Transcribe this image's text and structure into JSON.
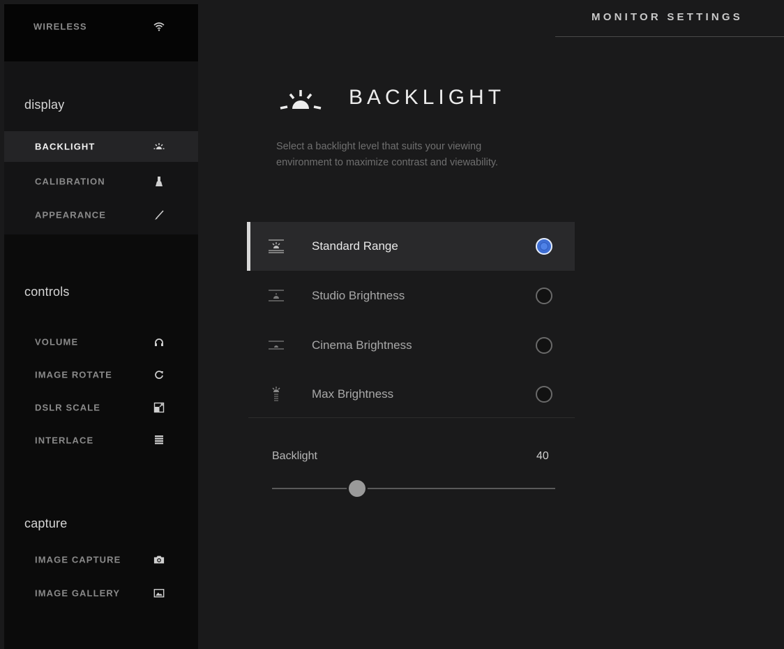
{
  "header": {
    "title": "MONITOR SETTINGS"
  },
  "sidebar": {
    "wireless": {
      "label": "WIRELESS",
      "icon": "wifi-icon"
    },
    "sections": {
      "display": {
        "title": "display",
        "items": [
          {
            "label": "BACKLIGHT",
            "icon": "backlight-icon",
            "active": true
          },
          {
            "label": "CALIBRATION",
            "icon": "calibration-probe-icon",
            "active": false
          },
          {
            "label": "APPEARANCE",
            "icon": "brush-icon",
            "active": false
          }
        ]
      },
      "controls": {
        "title": "controls",
        "items": [
          {
            "label": "VOLUME",
            "icon": "headphones-icon"
          },
          {
            "label": "IMAGE ROTATE",
            "icon": "rotate-icon"
          },
          {
            "label": "DSLR SCALE",
            "icon": "scale-icon"
          },
          {
            "label": "INTERLACE",
            "icon": "interlace-icon"
          }
        ]
      },
      "capture": {
        "title": "capture",
        "items": [
          {
            "label": "IMAGE CAPTURE",
            "icon": "camera-icon"
          },
          {
            "label": "IMAGE GALLERY",
            "icon": "gallery-icon"
          }
        ]
      }
    }
  },
  "panel": {
    "title": "BACKLIGHT",
    "icon": "backlight-icon",
    "description": "Select a backlight level that suits your viewing environment to maximize contrast and viewability.",
    "options": [
      {
        "label": "Standard Range",
        "icon": "standard-range-icon",
        "selected": true
      },
      {
        "label": "Studio Brightness",
        "icon": "studio-brightness-icon",
        "selected": false
      },
      {
        "label": "Cinema Brightness",
        "icon": "cinema-brightness-icon",
        "selected": false
      },
      {
        "label": "Max Brightness",
        "icon": "max-brightness-icon",
        "selected": false
      }
    ],
    "slider": {
      "label": "Backlight",
      "value": "40",
      "level": 0.3
    }
  },
  "colors": {
    "accent": "#4f82e6",
    "background": "#1a1a1b",
    "sidebar": "#0b0b0b"
  }
}
